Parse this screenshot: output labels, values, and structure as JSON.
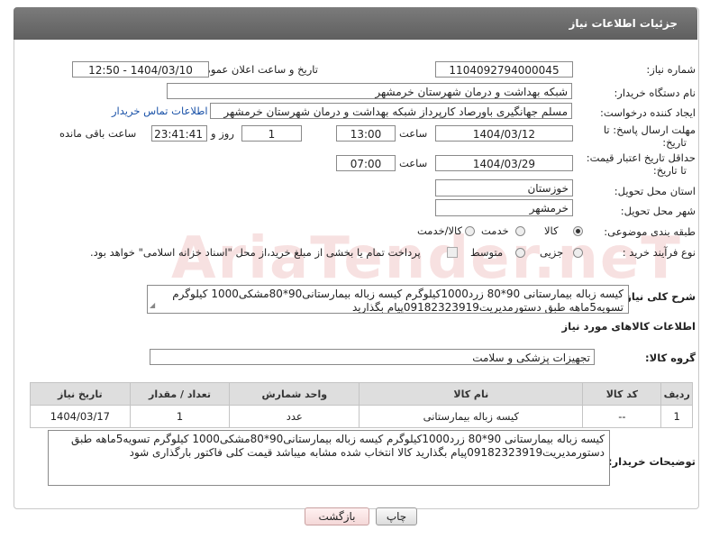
{
  "header": {
    "title": "جزئیات اطلاعات نیاز"
  },
  "fields": {
    "need_number_label": "شماره نیاز:",
    "need_number": "1104092794000045",
    "announce_datetime_label": "تاریخ و ساعت اعلان عمومی:",
    "announce_datetime": "1404/03/10 - 12:50",
    "buyer_org_label": "نام دستگاه خریدار:",
    "buyer_org": "شبکه بهداشت و درمان شهرستان خرمشهر",
    "creator_label": "ایجاد کننده درخواست:",
    "creator": "مسلم جهانگیری باورصاد کارپرداز شبکه بهداشت و درمان شهرستان خرمشهر",
    "contact_link": "اطلاعات تماس خریدار",
    "reply_deadline_label_1": "مهلت ارسال پاسخ: تا",
    "reply_deadline_label_2": "تاریخ:",
    "reply_date": "1404/03/12",
    "time_label": "ساعت",
    "reply_time": "13:00",
    "days_value": "1",
    "days_label": "روز و",
    "remaining_time": "23:41:41",
    "remaining_label": "ساعت باقی مانده",
    "validity_label_1": "حداقل تاریخ اعتبار قیمت:",
    "validity_label_2": "تا تاریخ:",
    "validity_date": "1404/03/29",
    "validity_time_label": "ساعت",
    "validity_time": "07:00",
    "province_label": "استان محل تحویل:",
    "province": "خوزستان",
    "city_label": "شهر محل تحویل:",
    "city": "خرمشهر",
    "category_label": "طبقه بندی موضوعی:",
    "category_options": [
      "کالا",
      "خدمت",
      "کالا/خدمت"
    ],
    "category_selected": "کالا",
    "process_label": "نوع فرآیند خرید :",
    "process_options": [
      "جزیی",
      "متوسط"
    ],
    "process_note": "پرداخت تمام یا بخشی از مبلغ خرید،از محل \"اسناد خزانه اسلامی\" خواهد بود.",
    "description_label": "شرح کلی نیاز:",
    "description": "کیسه زباله بیمارستانی 90*80 زرد1000کیلوگرم کیسه زباله بیمارستانی90*80مشکی1000 کیلوگرم تسویه5ماهه طبق دستورمدیریت09182323919پیام بگذارید"
  },
  "goods": {
    "section_title": "اطلاعات کالاهای مورد نیاز",
    "group_label": "گروه کالا:",
    "group_value": "تجهیزات پزشکی و سلامت",
    "columns": [
      "ردیف",
      "کد کالا",
      "نام کالا",
      "واحد شمارش",
      "تعداد / مقدار",
      "تاریخ نیاز"
    ],
    "rows": [
      {
        "row": "1",
        "code": "--",
        "name": "کیسه زباله بیمارستانی",
        "unit": "عدد",
        "qty": "1",
        "date": "1404/03/17"
      }
    ]
  },
  "buyer_notes": {
    "label": "توضیحات خریدار:",
    "text": "کیسه زباله بیمارستانی 90*80 زرد1000کیلوگرم کیسه زباله بیمارستانی90*80مشکی1000 کیلوگرم تسویه5ماهه طبق دستورمدیریت09182323919پیام بگذارید کالا انتخاب شده مشابه میباشد قیمت کلی فاکتور بارگذاری شود"
  },
  "buttons": {
    "print": "چاپ",
    "back": "بازگشت"
  },
  "watermark": "AriaTender.neT",
  "colors": {
    "header_bg": "#6b6b6b",
    "link": "#1a52a8",
    "back_button": "#f4d8d8"
  }
}
